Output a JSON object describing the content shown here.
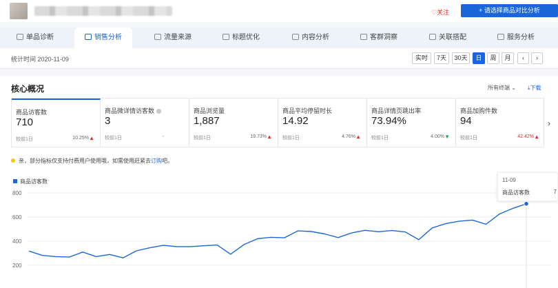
{
  "header": {
    "follow_label": "♡关注",
    "compare_label": "+ 请选择商品对比分析"
  },
  "nav": {
    "tabs": [
      {
        "label": "单品诊断",
        "icon": "document-icon"
      },
      {
        "label": "销售分析",
        "icon": "bag-icon",
        "active": true
      },
      {
        "label": "流量来源",
        "icon": "trend-icon"
      },
      {
        "label": "标题优化",
        "icon": "trend-icon"
      },
      {
        "label": "内容分析",
        "icon": "list-icon"
      },
      {
        "label": "客群洞察",
        "icon": "user-icon"
      },
      {
        "label": "关联搭配",
        "icon": "chat-icon"
      },
      {
        "label": "服务分析",
        "icon": "headset-icon"
      }
    ]
  },
  "stat": {
    "date_text": "统计时间 2020-11-09",
    "periods": [
      "实时",
      "7天",
      "30天",
      "日",
      "周",
      "月"
    ],
    "selected_period": "日",
    "prev": "‹",
    "next": "›"
  },
  "core": {
    "title": "核心概况",
    "terminal": "所有终端 ⌄",
    "download": "⤓下载",
    "compare_label": "较前1日",
    "metrics": [
      {
        "name": "商品访客数",
        "value": "710",
        "change": "10.25%",
        "dir": "up"
      },
      {
        "name": "商品微详情访客数",
        "value": "3",
        "change": "-",
        "dir": "none"
      },
      {
        "name": "商品浏览量",
        "value": "1,887",
        "change": "19.73%",
        "dir": "up"
      },
      {
        "name": "商品平均停留时长",
        "value": "14.92",
        "change": "4.76%",
        "dir": "up"
      },
      {
        "name": "商品详情页跳出率",
        "value": "73.94%",
        "change": "4.00%",
        "dir": "down"
      },
      {
        "name": "商品加购件数",
        "value": "94",
        "change": "42.42%",
        "dir": "up",
        "highlight": true
      }
    ],
    "notice_text": "亲，部分指标仅支持付费用户使用哦，如需使用赶紧去",
    "notice_link": "订购",
    "notice_suffix": "吧。"
  },
  "colors": {
    "accent": "#1a66d8",
    "up": "#e0282e",
    "down": "#1aa65a"
  },
  "chart_data": {
    "type": "line",
    "series": [
      {
        "name": "商品访客数",
        "values": [
          318,
          282,
          272,
          268,
          310,
          272,
          290,
          262,
          320,
          345,
          365,
          355,
          355,
          362,
          368,
          292,
          372,
          420,
          432,
          428,
          485,
          480,
          460,
          430,
          468,
          490,
          478,
          488,
          476,
          412,
          510,
          545,
          565,
          575,
          540,
          625,
          672,
          710
        ]
      }
    ],
    "ylim": [
      200,
      800
    ],
    "y_ticks": [
      200,
      400,
      600,
      800
    ],
    "tooltip": {
      "date": "11-09",
      "name": "商品访客数",
      "value": "7"
    }
  }
}
